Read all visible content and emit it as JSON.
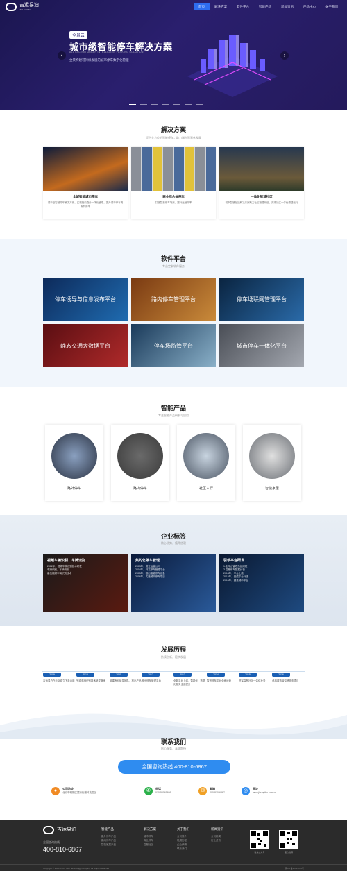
{
  "header": {
    "logo_name": "吉运易泊",
    "logo_en": "JIYUN YIBO",
    "nav": [
      "首页",
      "解决方案",
      "软件平台",
      "智能产品",
      "新闻资讯",
      "产品中心",
      "关于我们"
    ]
  },
  "hero": {
    "tag": "全景云",
    "title": "城市级智能停车解决方案",
    "title_en": "ALL FACTOR URBAN INTELLIGENT PARKING SOLUTION",
    "subtitle": "全景构建可持续发展的城市停车数字化管理"
  },
  "solutions": {
    "title": "解决方案",
    "subtitle": "提供全方位的智能停车，助力城市智慧化发展",
    "cards": [
      {
        "name": "全域智能城市停车",
        "desc": "城市级智慧停车解决方案，实现路内路外一体化管理，提升城市停车资源利用率"
      },
      {
        "name": "商业综合体停车",
        "desc": "打造智慧停车场景，提升运营效率"
      },
      {
        "name": "一体化智慧社区",
        "desc": "城市智慧社区解决方案助力社区管理升级，实现社区一体化便捷出行"
      }
    ]
  },
  "software": {
    "title": "软件平台",
    "subtitle": "专业定制软件服务",
    "tiles": [
      "停车诱导与信息发布平台",
      "路内停车管理平台",
      "停车场联网管理平台",
      "静态交通大数据平台",
      "停车场监管平台",
      "城市停车一体化平台"
    ]
  },
  "products": {
    "title": "智能产品",
    "subtitle": "专注智能产品研发与应用",
    "items": [
      "路外停车",
      "路内停车",
      "社区人行",
      "智能家居"
    ]
  },
  "enterprise": {
    "title": "企业标签",
    "subtitle": "核心优势，值得信赖",
    "cards": [
      {
        "title": "视频车辆识别、车牌识别",
        "lines": [
          "2012年，视频车牌识别技术研发",
          "车牌识别、车辆识别",
          "高位视频车辆识别技术"
        ]
      },
      {
        "title": "集约化停车管理",
        "lines": [
          "2013年，成立运营公司",
          "2014年，开发停车管理平台",
          "2015年，推出智能停车设备",
          "2016年，实施城市停车项目"
        ]
      },
      {
        "title": "引领平台研发",
        "lines": [
          "1.全平台管理系统研发",
          "2.智慧停车数据分析",
          "2014年，平台上线",
          "2015年，完成平台升级",
          "2016年，建设城市平台"
        ]
      }
    ]
  },
  "history": {
    "title": "发展历程",
    "subtitle": "持续创新，稳步发展",
    "items": [
      {
        "year": "2009",
        "text": "吉运易泊在北京成立下手运用"
      },
      {
        "year": "2010",
        "text": "完成车牌识别技术研发落地"
      },
      {
        "year": "2011",
        "text": "组建专业研发团队，推出产品"
      },
      {
        "year": "2012",
        "text": "推出停车管理平台"
      },
      {
        "year": "2013",
        "text": "全新平台上线，智能化、数据化服务全面提升"
      },
      {
        "year": "2014",
        "text": "智慧停车平台全面运营"
      },
      {
        "year": "2015",
        "text": "进军智慧社区一体化业务"
      },
      {
        "year": "2016",
        "text": "承接城市级智慧停车项目"
      }
    ]
  },
  "contact": {
    "title": "联系我们",
    "subtitle": "贴心服务，真诚期待",
    "hotline": "全国咨询热线  400-810-6867",
    "items": [
      {
        "icon": "location",
        "label": "公司地址",
        "text": "北京市朝阳区望京街道科技园区"
      },
      {
        "icon": "phone",
        "label": "电话",
        "text": "010-56161686"
      },
      {
        "icon": "mail",
        "label": "邮箱",
        "text": "400-810-6867"
      },
      {
        "icon": "globe",
        "label": "网址",
        "text": "www.jiyunyibo.com.cn"
      }
    ]
  },
  "footer": {
    "tel_label": "全国咨询热线",
    "tel": "400-810-6867",
    "columns": [
      {
        "head": "智能产品",
        "items": [
          "路外停车产品",
          "路内停车产品",
          "智能家居产品"
        ]
      },
      {
        "head": "解决方案",
        "items": [
          "城市停车",
          "商业停车",
          "智慧社区"
        ]
      },
      {
        "head": "关于我们",
        "items": [
          "公司简介",
          "发展历程",
          "企业荣誉",
          "联系我们"
        ]
      },
      {
        "head": "新闻资讯",
        "items": [
          "公司新闻",
          "行业资讯"
        ]
      }
    ],
    "qr_labels": [
      "微信公众号",
      "官方微博"
    ],
    "copyright": "Copyright © 2018 JiYun YiBo Technology Company All Rights Reserved",
    "icp": "京ICP备12345678号"
  }
}
